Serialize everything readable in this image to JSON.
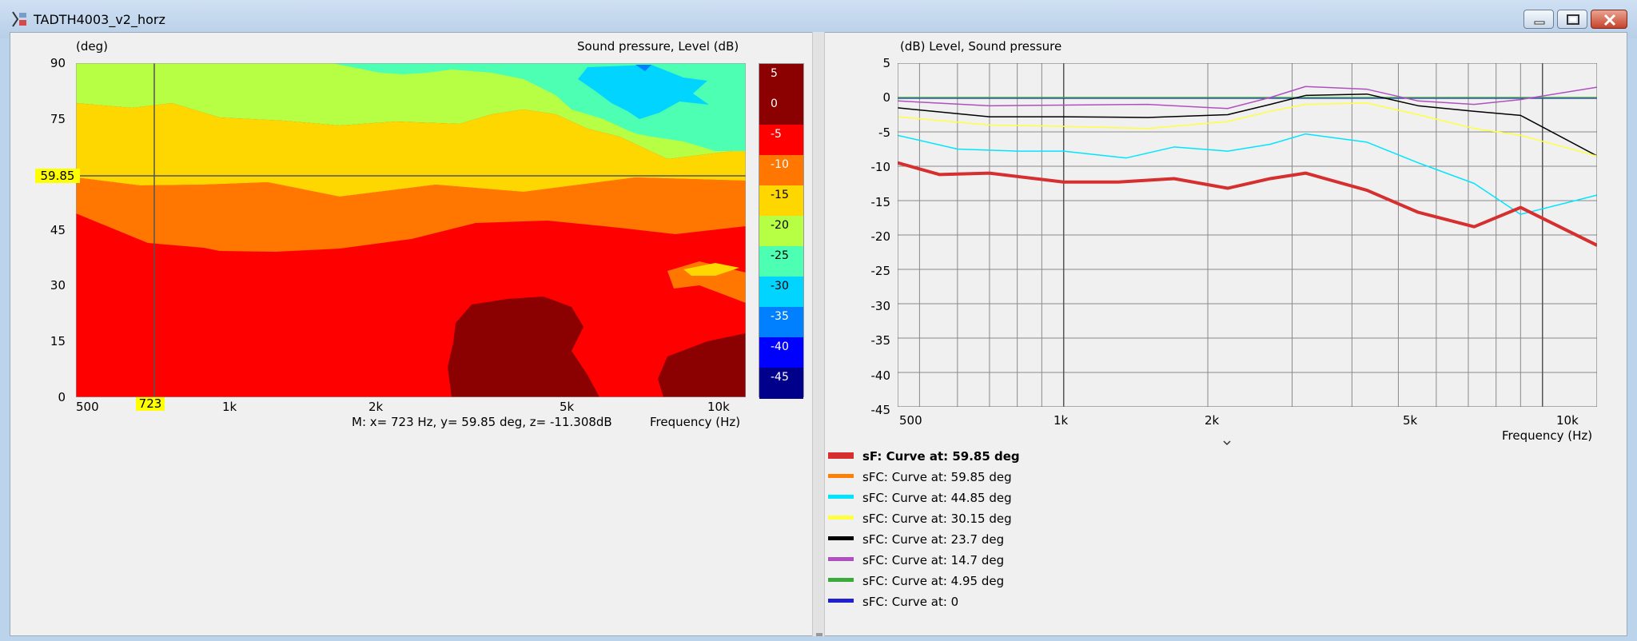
{
  "window": {
    "title": "TADTH4003_v2_horz"
  },
  "contour": {
    "y_axis_label": "(deg)",
    "z_axis_label": "Sound pressure, Level  (dB)",
    "x_axis_label": "Frequency  (Hz)",
    "y_ticks": [
      "90",
      "75",
      "60",
      "45",
      "30",
      "15",
      "0"
    ],
    "x_ticks": [
      "500",
      "1k",
      "2k",
      "5k",
      "10k"
    ],
    "cursor": {
      "y_value": "59.85",
      "x_value": "723"
    },
    "measure": "M:  x= 723 Hz,  y= 59.85 deg, z= -11.308dB",
    "color_scale": [
      {
        "label": "5",
        "color": "#8b0000"
      },
      {
        "label": "0",
        "color": "#8b0000"
      },
      {
        "label": "-5",
        "color": "#ff0000"
      },
      {
        "label": "-10",
        "color": "#ff7700"
      },
      {
        "label": "-15",
        "color": "#ffd700"
      },
      {
        "label": "-20",
        "color": "#b7ff45"
      },
      {
        "label": "-25",
        "color": "#4dffb3"
      },
      {
        "label": "-30",
        "color": "#00d4ff"
      },
      {
        "label": "-35",
        "color": "#0080ff"
      },
      {
        "label": "-40",
        "color": "#0000ff"
      },
      {
        "label": "-45",
        "color": "#00008b"
      }
    ]
  },
  "linechart": {
    "y_axis_label": "(dB)  Level, Sound pressure",
    "x_axis_label": "Frequency  (Hz)",
    "y_ticks": [
      "5",
      "0",
      "-5",
      "-10",
      "-15",
      "-20",
      "-25",
      "-30",
      "-35",
      "-40",
      "-45"
    ],
    "x_ticks": [
      "500",
      "1k",
      "2k",
      "5k",
      "10k"
    ]
  },
  "legend": [
    {
      "label": "sF: Curve at: 59.85 deg",
      "color": "#d62f2f",
      "bold": true
    },
    {
      "label": "sFC: Curve at: 59.85 deg",
      "color": "#ff8000"
    },
    {
      "label": "sFC: Curve at: 44.85 deg",
      "color": "#00e5ff"
    },
    {
      "label": "sFC: Curve at: 30.15 deg",
      "color": "#ffff40"
    },
    {
      "label": "sFC: Curve at: 23.7 deg",
      "color": "#000000"
    },
    {
      "label": "sFC: Curve at: 14.7 deg",
      "color": "#b050c0"
    },
    {
      "label": "sFC: Curve at: 4.95 deg",
      "color": "#3aaa3a"
    },
    {
      "label": "sFC: Curve at: 0",
      "color": "#2020d0"
    }
  ],
  "chart_data": {
    "type": "line",
    "xlabel": "Frequency  (Hz)",
    "ylabel": "(dB)  Level, Sound pressure",
    "xscale": "log",
    "xlim": [
      450,
      13000
    ],
    "ylim": [
      -45,
      5
    ],
    "grid": true,
    "legend_position": "below",
    "series": [
      {
        "name": "sF: Curve at: 59.85 deg",
        "color": "#d62f2f",
        "width": 4,
        "x": [
          450,
          550,
          700,
          1000,
          1300,
          1700,
          2200,
          2700,
          3200,
          4300,
          5500,
          7200,
          9000,
          13000
        ],
        "y": [
          -9.5,
          -11.2,
          -11,
          -12.3,
          -12.3,
          -11.8,
          -13.2,
          -11.8,
          -11,
          -13.5,
          -16.7,
          -18.8,
          -16,
          -21.5
        ]
      },
      {
        "name": "sFC: Curve at: 44.85 deg",
        "color": "#00e5ff",
        "width": 1.5,
        "x": [
          450,
          600,
          800,
          1000,
          1350,
          1700,
          2200,
          2700,
          3200,
          4300,
          5500,
          7200,
          9000,
          13000
        ],
        "y": [
          -5.5,
          -7.5,
          -7.8,
          -7.8,
          -8.8,
          -7.2,
          -7.8,
          -6.8,
          -5.3,
          -6.5,
          -9.5,
          -12.5,
          -17,
          -14.2
        ]
      },
      {
        "name": "sFC: Curve at: 30.15 deg",
        "color": "#ffff40",
        "width": 1.5,
        "x": [
          450,
          700,
          1000,
          1500,
          2200,
          2700,
          3200,
          4300,
          5500,
          7200,
          9000,
          13000
        ],
        "y": [
          -2.8,
          -4,
          -4.2,
          -4.5,
          -3.5,
          -2,
          -1,
          -0.8,
          -2.5,
          -4.5,
          -5.5,
          -8.5
        ]
      },
      {
        "name": "sFC: Curve at: 23.7 deg",
        "color": "#000000",
        "width": 1.5,
        "x": [
          450,
          700,
          1000,
          1500,
          2200,
          2700,
          3200,
          4300,
          5500,
          7200,
          9000,
          13000
        ],
        "y": [
          -1.5,
          -2.8,
          -2.8,
          -2.9,
          -2.5,
          -1,
          0.3,
          0.5,
          -1.2,
          -2,
          -2.6,
          -8.5
        ]
      },
      {
        "name": "sFC: Curve at: 14.7 deg",
        "color": "#b050c0",
        "width": 1.5,
        "x": [
          450,
          700,
          1000,
          1500,
          2200,
          2700,
          3200,
          4300,
          5500,
          7200,
          9000,
          13000
        ],
        "y": [
          -0.5,
          -1.2,
          -1.1,
          -1,
          -1.6,
          0,
          1.6,
          1.2,
          -0.5,
          -1,
          -0.3,
          1.5
        ]
      },
      {
        "name": "sFC: Curve at: 4.95 deg",
        "color": "#3aaa3a",
        "width": 1.5,
        "x": [
          450,
          13000
        ],
        "y": [
          0,
          0
        ]
      },
      {
        "name": "sFC: Curve at: 0",
        "color": "#2020d0",
        "width": 1.5,
        "x": [
          450,
          1000,
          2000,
          3000,
          4500,
          7000,
          10000,
          13000
        ],
        "y": [
          -0.1,
          -0.1,
          -0.1,
          -0.1,
          -0.1,
          -0.1,
          -0.1,
          -0.1
        ]
      }
    ]
  }
}
